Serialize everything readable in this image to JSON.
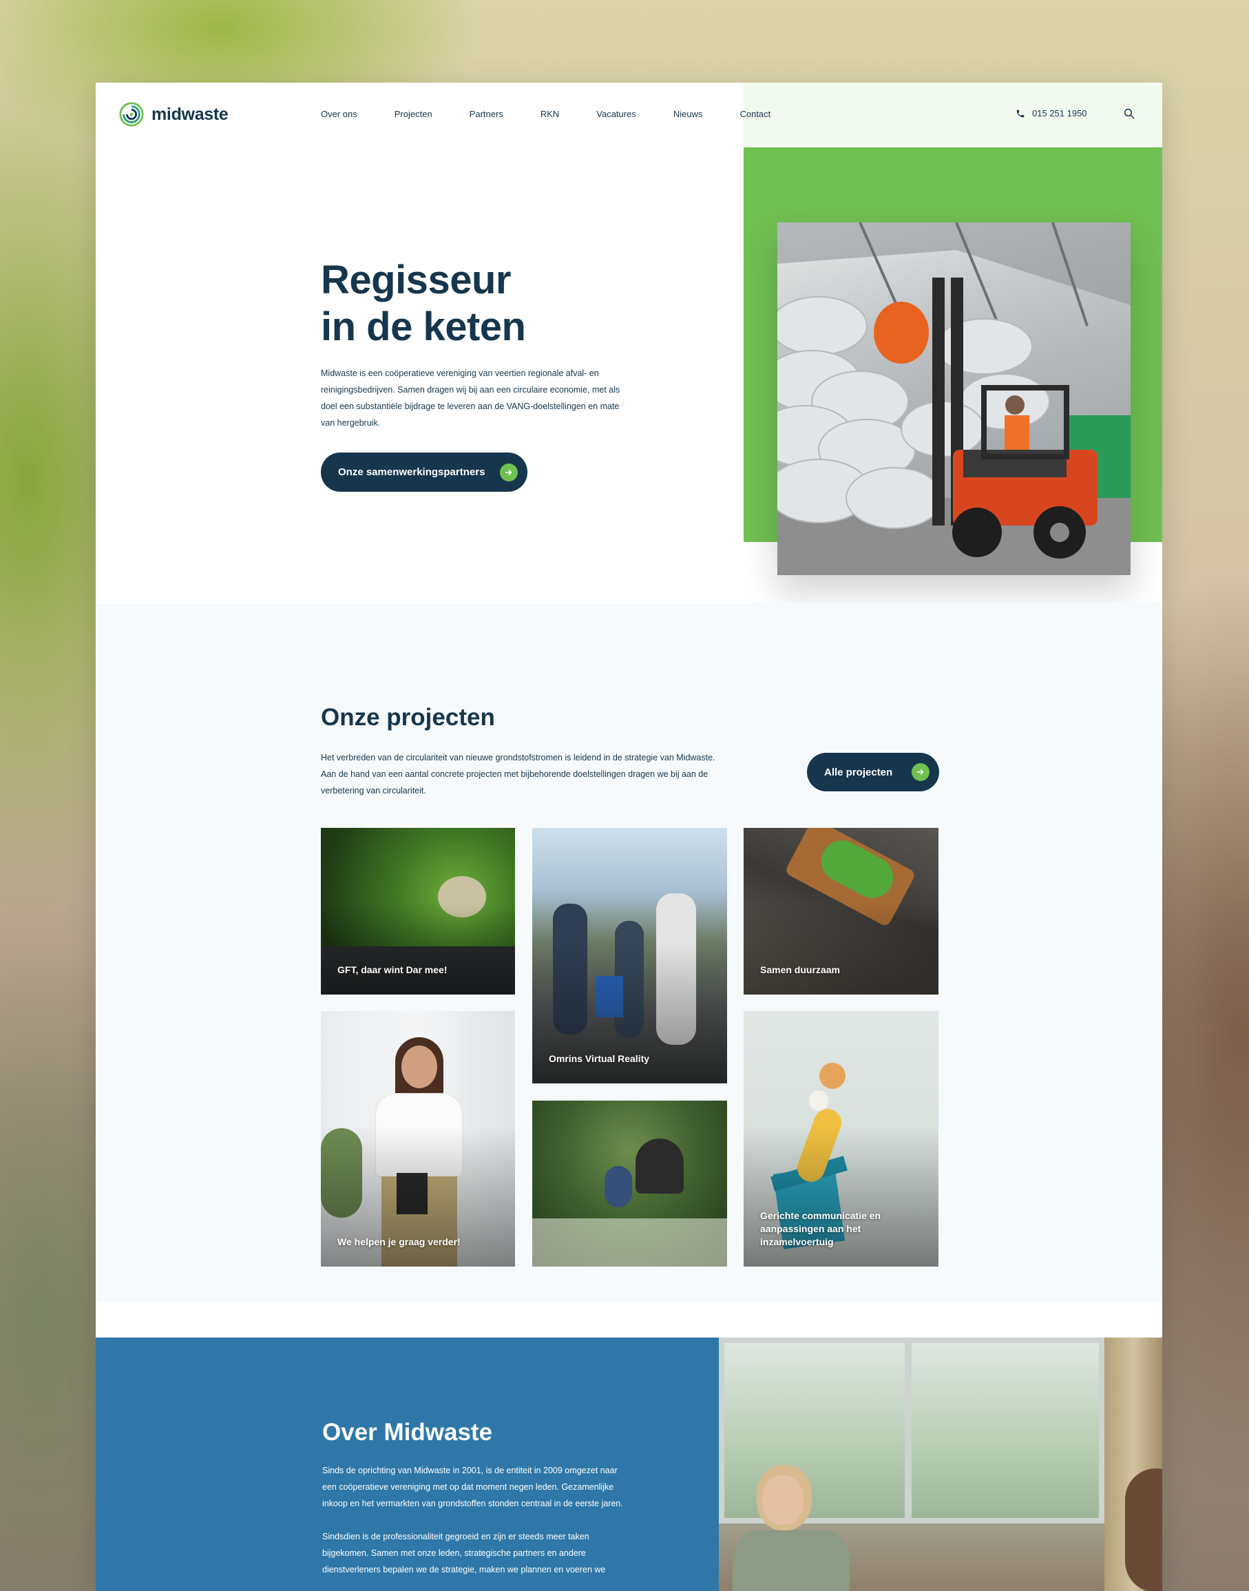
{
  "brand": {
    "name": "midwaste",
    "accent": "#71c052",
    "dark": "#16364d",
    "blue": "#2e77a8"
  },
  "nav": [
    "Over ons",
    "Projecten",
    "Partners",
    "RKN",
    "Vacatures",
    "Nieuws",
    "Contact"
  ],
  "header": {
    "phone": "015 251 1950",
    "phone_icon": "phone-icon",
    "search_icon": "search-icon"
  },
  "hero": {
    "title_line1": "Regisseur",
    "title_line2": "in de keten",
    "text": "Midwaste is een coöperatieve vereniging van veertien regionale afval- en reinigingsbedrijven. Samen dragen wij bij aan een circulaire economie, met als doel een substantiële bijdrage te leveren aan de VANG-doelstellingen en mate van hergebruik.",
    "button": "Onze samenwerkingspartners"
  },
  "projects": {
    "title": "Onze projecten",
    "text": "Het verbreden van de circulariteit van nieuwe grondstofstromen is leidend in de strategie van Midwaste. Aan de hand van een aantal concrete projecten met bijbehorende doelstellingen dragen we bij aan de verbetering van circulariteit.",
    "button": "Alle projecten",
    "tiles": [
      {
        "caption": "GFT, daar wint Dar mee!"
      },
      {
        "caption": "Omrins Virtual Reality"
      },
      {
        "caption": "Samen duurzaam"
      },
      {
        "caption": "We helpen je graag verder!"
      },
      {
        "caption": ""
      },
      {
        "caption": "Gerichte communicatie en aanpassingen aan het inzamelvoertuig"
      }
    ]
  },
  "about": {
    "title": "Over Midwaste",
    "p1": "Sinds de oprichting van Midwaste in 2001, is de entiteit in 2009 omgezet naar een coöperatieve vereniging met op dat moment negen leden. Gezamenlijke inkoop en het vermarkten van grondstoffen stonden centraal in de eerste jaren.",
    "p2": "Sindsdien is de professionaliteit gegroeid en zijn er steeds meer taken bijgekomen. Samen met onze leden, strategische partners en andere dienstverleners bepalen we de strategie, maken we plannen en voeren we"
  }
}
